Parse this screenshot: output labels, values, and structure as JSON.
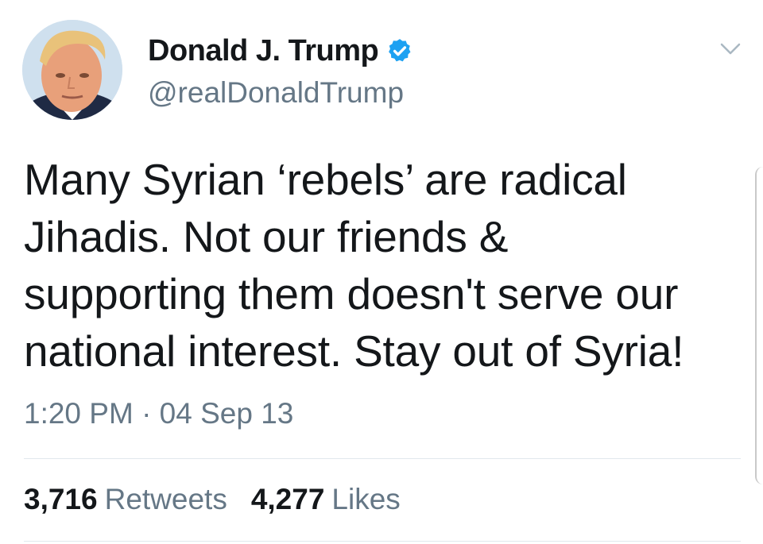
{
  "author": {
    "display_name": "Donald J. Trump",
    "handle": "@realDonaldTrump",
    "verified": true,
    "avatar_icon": "profile-photo"
  },
  "tweet": {
    "lines": [
      "Many Syrian ‘rebels’ are radical",
      "Jihadis. Not our friends &",
      "supporting them doesn't serve our",
      "national interest. Stay out of Syria!"
    ],
    "timestamp": "1:20 PM · 04 Sep 13"
  },
  "stats": {
    "retweets_count": "3,716",
    "retweets_label": "Retweets",
    "likes_count": "4,277",
    "likes_label": "Likes"
  },
  "colors": {
    "verified_blue": "#1da1f2",
    "secondary_text": "#657786",
    "primary_text": "#14171a",
    "divider": "#e1e8ed"
  }
}
